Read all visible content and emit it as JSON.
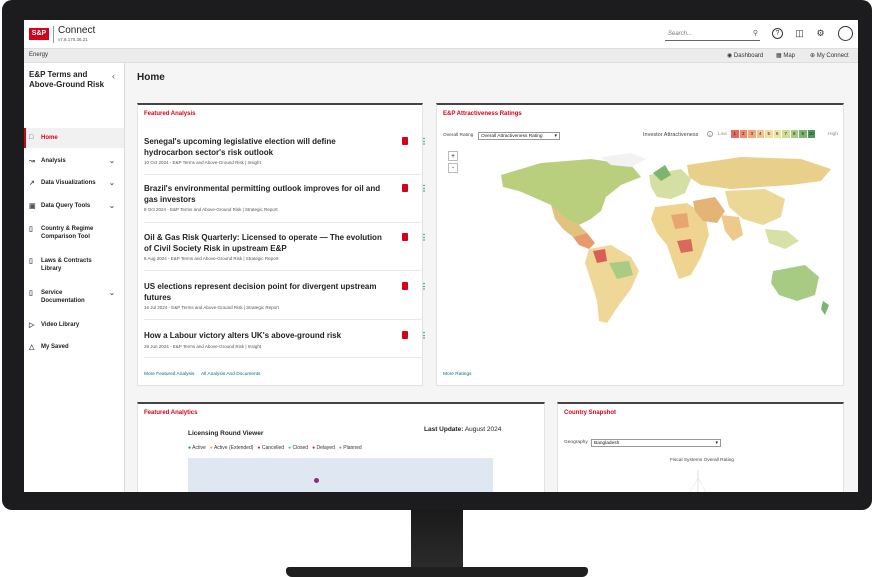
{
  "app": {
    "logo": "S&P",
    "name": "Connect",
    "version": "v7.8.170.36.21"
  },
  "search": {
    "placeholder": "Search..."
  },
  "subbar": {
    "title": "Energy",
    "links": [
      "Dashboard",
      "Map",
      "My Connect"
    ]
  },
  "sidebar": {
    "title": "E&P Terms and Above-Ground Risk",
    "items": [
      {
        "label": "Home",
        "icon": "home-icon",
        "expandable": false,
        "active": true
      },
      {
        "label": "Analysis",
        "icon": "analysis-icon",
        "expandable": true
      },
      {
        "label": "Data Visualizations",
        "icon": "chart-line-icon",
        "expandable": true
      },
      {
        "label": "Data Query Tools",
        "icon": "folder-icon",
        "expandable": true
      },
      {
        "label": "Country & Regime Comparison Tool",
        "icon": "document-icon",
        "expandable": false
      },
      {
        "label": "Laws & Contracts Library",
        "icon": "document-icon",
        "expandable": false
      },
      {
        "label": "Service Documentation",
        "icon": "document-icon",
        "expandable": true
      },
      {
        "label": "Video Library",
        "icon": "play-icon",
        "expandable": false
      },
      {
        "label": "My Saved",
        "icon": "bookmark-icon",
        "expandable": false
      }
    ]
  },
  "main": {
    "title": "Home"
  },
  "featured_analysis": {
    "title": "Featured Analysis",
    "articles": [
      {
        "title": "Senegal's upcoming legislative election will define hydrocarbon sector's risk outlook",
        "meta": "10 Oct 2024 - E&P Terms and Above-Ground Risk | Insight"
      },
      {
        "title": "Brazil's environmental permitting outlook improves for oil and gas investors",
        "meta": "8 Oct 2024 - E&P Terms and Above-Ground Risk | Strategic Report"
      },
      {
        "title": "Oil & Gas Risk Quarterly: Licensed to operate — The evolution of Civil Society Risk in upstream E&P",
        "meta": "8 Aug 2024 - E&P Terms and Above-Ground Risk | Strategic Report"
      },
      {
        "title": "US elections represent decision point for divergent upstream futures",
        "meta": "16 Jul 2024 - E&P Terms and Above-Ground Risk | Strategic Report"
      },
      {
        "title": "How a Labour victory alters UK's above-ground risk",
        "meta": "28 Jun 2024 - E&P Terms and Above-Ground Risk | Insight"
      }
    ],
    "links": [
      "More Featured Analysis",
      "All Analysis And Documents"
    ]
  },
  "ratings": {
    "title": "E&P Attractiveness Ratings",
    "overall_label": "Overall Rating",
    "overall_value": "Overall Attractiveness Rating",
    "legend_label": "Investor Attractiveness",
    "low": "Low",
    "high": "High",
    "scale": [
      "1",
      "2",
      "3",
      "4",
      "5",
      "6",
      "7",
      "8",
      "9",
      "10"
    ],
    "scale_colors": [
      "#e8675f",
      "#ef8a6c",
      "#f2a77a",
      "#f5c48e",
      "#f6dc9e",
      "#ece5a1",
      "#cfdc96",
      "#a8cb84",
      "#7bb56f",
      "#4e9a5a"
    ],
    "zoom_in": "+",
    "zoom_out": "-",
    "more_link": "More Ratings"
  },
  "analytics": {
    "title": "Featured Analytics",
    "chart_title": "Licensing Round Viewer",
    "last_update_label": "Last Update:",
    "last_update_value": "August 2024",
    "legend": [
      {
        "label": "Active",
        "color": "#1c7e8c"
      },
      {
        "label": "Active (Extended)",
        "color": "#f0a53a"
      },
      {
        "label": "Cancelled",
        "color": "#8b2f78"
      },
      {
        "label": "Closed",
        "color": "#5ab8c4"
      },
      {
        "label": "Delayed",
        "color": "#c0253c"
      },
      {
        "label": "Planned",
        "color": "#999999"
      }
    ]
  },
  "snapshot": {
    "title": "Country Snapshot",
    "geography_label": "Geography",
    "geography_value": "Bangladesh",
    "chart_title": "Fiscal Systems Overall Rating"
  }
}
